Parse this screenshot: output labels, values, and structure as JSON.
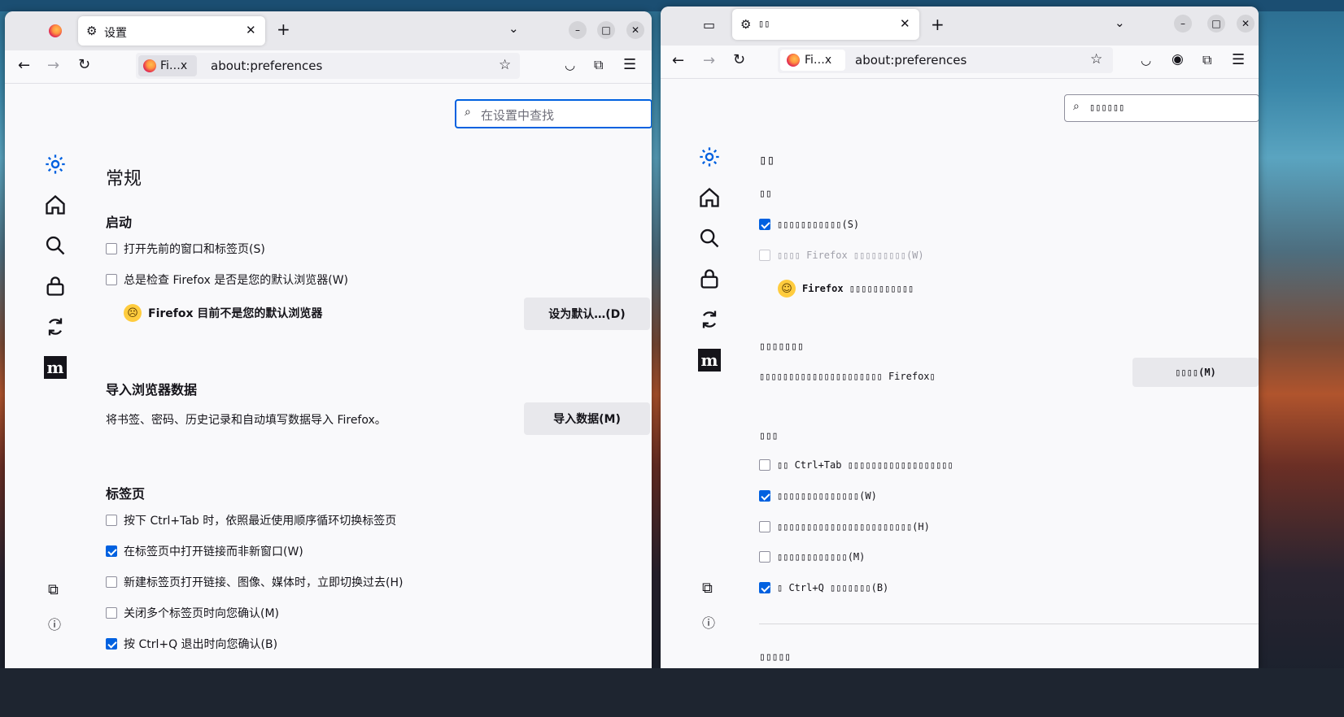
{
  "left_window": {
    "tab_title": "设置",
    "identity_label": "Fi…x",
    "url": "about:preferences",
    "search_placeholder": "在设置中查找",
    "page_title": "常规",
    "startup": {
      "heading": "启动",
      "restore_label": "打开先前的窗口和标签页(S)",
      "check_default_label": "总是检查 Firefox 是否是您的默认浏览器(W)",
      "default_status": "Firefox 目前不是您的默认浏览器",
      "make_default_button": "设为默认…(D)"
    },
    "import": {
      "heading": "导入浏览器数据",
      "description": "将书签、密码、历史记录和自动填写数据导入 Firefox。",
      "button": "导入数据(M)"
    },
    "tabs": {
      "heading": "标签页",
      "ctrl_tab_label": "按下 Ctrl+Tab 时，依照最近使用顺序循环切换标签页",
      "open_links_label": "在标签页中打开链接而非新窗口(W)",
      "switch_to_label": "新建标签页打开链接、图像、媒体时，立即切换过去(H)",
      "warn_close_label": "关闭多个标签页时向您确认(M)",
      "warn_quit_label": "按 Ctrl+Q 退出时向您确认(B)"
    }
  },
  "right_window": {
    "tab_title": "▯▯",
    "identity_label": "Fi…x",
    "url": "about:preferences",
    "search_placeholder": "▯▯▯▯▯▯",
    "page_title": "▯▯",
    "startup": {
      "heading": "▯▯",
      "restore_label": "▯▯▯▯▯▯▯▯▯▯▯(S)",
      "check_default_label": "▯▯▯▯ Firefox ▯▯▯▯▯▯▯▯▯(W)",
      "default_status": "Firefox ▯▯▯▯▯▯▯▯▯▯▯"
    },
    "import": {
      "heading": "▯▯▯▯▯▯▯",
      "description": "▯▯▯▯▯▯▯▯▯▯▯▯▯▯▯▯▯▯▯▯▯ Firefox▯",
      "button": "▯▯▯▯(M)"
    },
    "tabs": {
      "heading": "▯▯▯",
      "ctrl_tab_label": "▯▯ Ctrl+Tab ▯▯▯▯▯▯▯▯▯▯▯▯▯▯▯▯▯▯",
      "open_links_label": "▯▯▯▯▯▯▯▯▯▯▯▯▯▯(W)",
      "switch_to_label": "▯▯▯▯▯▯▯▯▯▯▯▯▯▯▯▯▯▯▯▯▯▯▯(H)",
      "warn_close_label": "▯▯▯▯▯▯▯▯▯▯▯▯(M)",
      "warn_quit_label": "▯ Ctrl+Q ▯▯▯▯▯▯▯(B)"
    },
    "next_heading": "▯▯▯▯▯"
  },
  "colors": {
    "accent": "#0061e0",
    "button_bg": "#e8e8ec",
    "page_bg": "#f9f9fb"
  }
}
